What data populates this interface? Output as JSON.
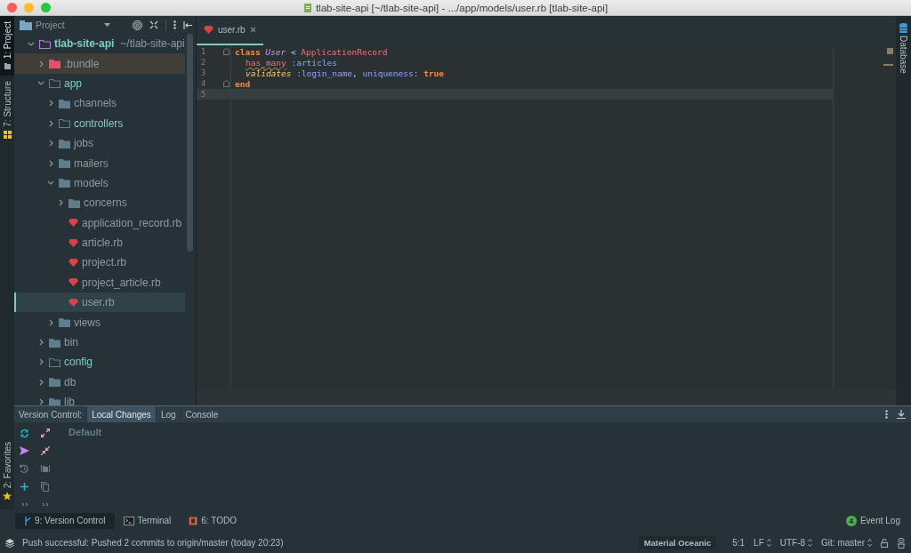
{
  "window": {
    "title": "tlab-site-api [~/tlab-site-api] - .../app/models/user.rb [tlab-site-api]"
  },
  "left_strip": [
    {
      "label": "1: Project",
      "kind": "project",
      "selected": true
    },
    {
      "label": "7: Structure",
      "kind": "structure",
      "selected": false
    }
  ],
  "left_strip_bottom": [
    {
      "label": "2: Favorites",
      "kind": "favorites",
      "selected": false
    }
  ],
  "project_panel": {
    "title": "Project",
    "tree": [
      {
        "label": "tlab-site-api",
        "path": "~/tlab-site-api",
        "kind": "module",
        "expanded": true,
        "selected": false,
        "children": [
          {
            "label": ".bundle",
            "kind": "excluded",
            "expanded": false,
            "selected": false
          },
          {
            "label": "app",
            "kind": "source",
            "expanded": true,
            "selected": false,
            "children": [
              {
                "label": "channels",
                "kind": "folder",
                "expanded": false,
                "selected": false
              },
              {
                "label": "controllers",
                "kind": "source",
                "expanded": false,
                "selected": false
              },
              {
                "label": "jobs",
                "kind": "folder",
                "expanded": false,
                "selected": false
              },
              {
                "label": "mailers",
                "kind": "folder",
                "expanded": false,
                "selected": false
              },
              {
                "label": "models",
                "kind": "folder",
                "expanded": true,
                "selected": false,
                "children": [
                  {
                    "label": "concerns",
                    "kind": "folder",
                    "expanded": false,
                    "selected": false
                  },
                  {
                    "label": "application_record.rb",
                    "kind": "ruby",
                    "selected": false
                  },
                  {
                    "label": "article.rb",
                    "kind": "ruby",
                    "selected": false
                  },
                  {
                    "label": "project.rb",
                    "kind": "ruby",
                    "selected": false
                  },
                  {
                    "label": "project_article.rb",
                    "kind": "ruby",
                    "selected": false
                  },
                  {
                    "label": "user.rb",
                    "kind": "ruby",
                    "selected": true
                  }
                ]
              },
              {
                "label": "views",
                "kind": "folder",
                "expanded": false,
                "selected": false
              }
            ]
          },
          {
            "label": "bin",
            "kind": "folder",
            "expanded": false,
            "selected": false
          },
          {
            "label": "config",
            "kind": "source",
            "expanded": false,
            "selected": false
          },
          {
            "label": "db",
            "kind": "folder",
            "expanded": false,
            "selected": false
          },
          {
            "label": "lib",
            "kind": "folder",
            "expanded": false,
            "selected": false
          }
        ]
      }
    ]
  },
  "editor": {
    "tabs": [
      {
        "label": "user.rb",
        "selected": true
      }
    ],
    "lines": [
      {
        "number": "1",
        "fold": true,
        "current": false,
        "indented": false,
        "tokens": [
          {
            "kind": "keyword",
            "text": "class"
          },
          {
            "kind": "classname",
            "text": "User"
          },
          {
            "kind": "operator",
            "text": "<"
          },
          {
            "kind": "constant",
            "text": "ApplicationRecord"
          }
        ]
      },
      {
        "number": "2",
        "fold": false,
        "current": false,
        "indented": true,
        "tokens": [
          {
            "kind": "warning",
            "text": "has_many"
          },
          {
            "kind": "symbol",
            "text": ":articles"
          }
        ]
      },
      {
        "number": "3",
        "fold": false,
        "current": false,
        "indented": true,
        "tokens": [
          {
            "kind": "method",
            "text": "validates"
          },
          {
            "kind": "symbol",
            "text": ":login_name"
          },
          {
            "kind": "punct",
            "text": ",",
            "joined": true
          },
          {
            "kind": "symbol",
            "text": "uniqueness:"
          },
          {
            "kind": "keyword",
            "text": "true"
          }
        ]
      },
      {
        "number": "4",
        "fold": true,
        "current": false,
        "indented": false,
        "tokens": [
          {
            "kind": "keyword",
            "text": "end"
          }
        ]
      },
      {
        "number": "5",
        "fold": false,
        "current": true,
        "indented": false
      }
    ]
  },
  "right_strip": [
    {
      "label": "Database",
      "selected": false
    }
  ],
  "vcs_panel": {
    "label": "Version Control:",
    "tabs": [
      {
        "label": "Local Changes",
        "selected": true
      },
      {
        "label": "Log",
        "selected": false
      },
      {
        "label": "Console",
        "selected": false
      }
    ],
    "changelist": "Default"
  },
  "tool_buttons": [
    {
      "label": "9: Version Control",
      "kind": "vcs",
      "selected": true
    },
    {
      "label": "Terminal",
      "kind": "terminal",
      "selected": false
    },
    {
      "label": "6: TODO",
      "kind": "todo",
      "selected": false
    }
  ],
  "event_log": {
    "count": "4",
    "label": "Event Log"
  },
  "status_bar": {
    "message": "Push successful: Pushed 2 commits to origin/master (today 20:23)",
    "theme": "Material Oceanic",
    "position": "5:1",
    "line_separator": "LF",
    "encoding": "UTF-8",
    "branch": "Git: master"
  }
}
